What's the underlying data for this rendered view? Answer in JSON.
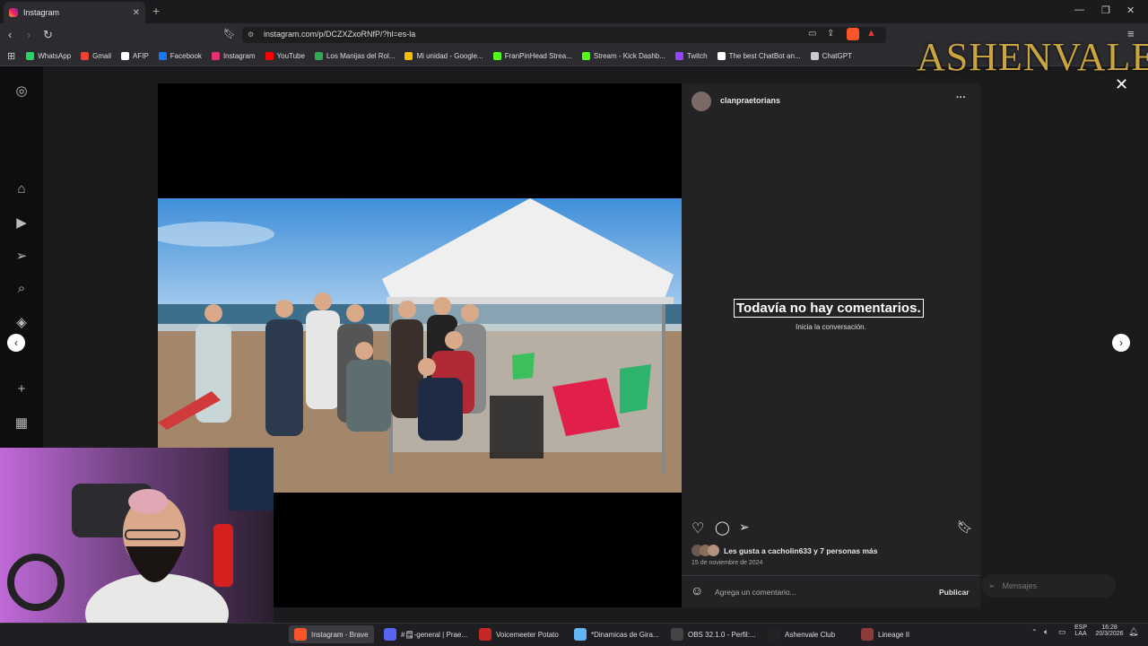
{
  "browser": {
    "tab_title": "Instagram",
    "url": "instagram.com/p/DCZXZxoRNfP/?hl=es-la",
    "new_tab_icon": "+",
    "bookmarks": [
      {
        "label": "WhatsApp",
        "color": "#25d366"
      },
      {
        "label": "Gmail",
        "color": "#ea4335"
      },
      {
        "label": "AFIP",
        "color": "#ffffff"
      },
      {
        "label": "Facebook",
        "color": "#1877f2"
      },
      {
        "label": "Instagram",
        "color": "#e1306c"
      },
      {
        "label": "YouTube",
        "color": "#ff0000"
      },
      {
        "label": "Los Manijas del Rol...",
        "color": "#34a853"
      },
      {
        "label": "Mi unidad - Google...",
        "color": "#fbbc04"
      },
      {
        "label": "FranPinHead Strea...",
        "color": "#53fc18"
      },
      {
        "label": "Stream - Kick Dashb...",
        "color": "#53fc18"
      },
      {
        "label": "Twitch",
        "color": "#9146ff"
      },
      {
        "label": "The best ChatBot an...",
        "color": "#ffffff"
      },
      {
        "label": "ChatGPT",
        "color": "#cccccc"
      }
    ]
  },
  "overlay_logo": "ASHENVALE",
  "post": {
    "username": "clanpraetorians",
    "empty_comments_title": "Todavía no hay comentarios.",
    "empty_comments_sub": "Inicia la conversación.",
    "likes_text": "Les gusta a cacholin633 y 7 personas más",
    "date": "15 de noviembre de 2024",
    "comment_placeholder": "Agrega un comentario...",
    "publish_label": "Publicar",
    "more_icon": "···"
  },
  "messages": {
    "label": "Mensajes"
  },
  "taskbar": {
    "items": [
      {
        "label": "Instagram - Brave",
        "color": "#fb542b",
        "active": true
      },
      {
        "label": "#🗒-general | Prae...",
        "color": "#5865f2",
        "active": false
      },
      {
        "label": "Voicemeeter Potato",
        "color": "#c62828",
        "active": false
      },
      {
        "label": "*Dinamicas de Gira...",
        "color": "#64b5f6",
        "active": false
      },
      {
        "label": "OBS 32.1.0 - Perfil:...",
        "color": "#444444",
        "active": false
      },
      {
        "label": "Ashenvale Club",
        "color": "#222222",
        "active": false
      },
      {
        "label": "Lineage II",
        "color": "#8d3b3b",
        "active": false
      }
    ],
    "lang_top": "ESP",
    "lang_bottom": "LAA",
    "time": "16:28",
    "date": "20/3/2026"
  }
}
